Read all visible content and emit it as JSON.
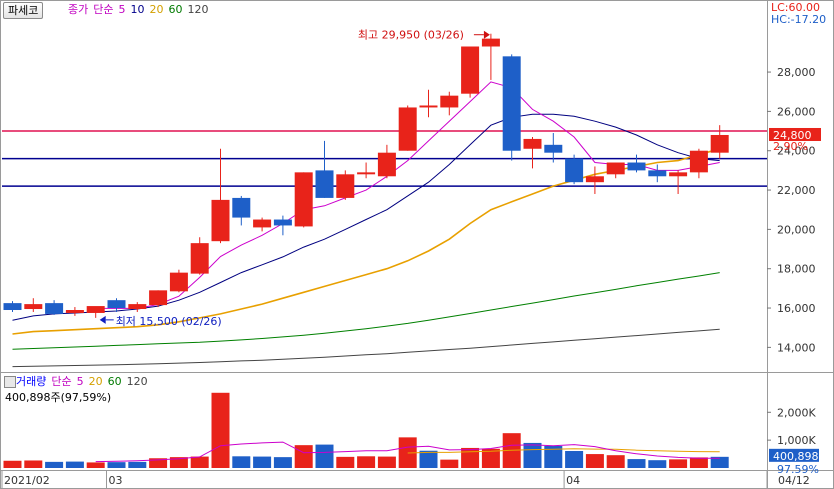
{
  "header": {
    "stock_name": "파세코",
    "main_legend": [
      {
        "text": "종가",
        "color": "#c000c0"
      },
      {
        "text": "단순",
        "color": "#c000c0"
      },
      {
        "text": "5",
        "color": "#c000c0"
      },
      {
        "text": "10",
        "color": "#00008b"
      },
      {
        "text": "20",
        "color": "#d4a000"
      },
      {
        "text": "60",
        "color": "#007a00"
      },
      {
        "text": "120",
        "color": "#444444"
      }
    ],
    "lc": "LC:60.00",
    "hc": "HC:-17.20"
  },
  "volume_header": {
    "legend": [
      {
        "text": "거래량",
        "color": "#0000ff"
      },
      {
        "text": "단순",
        "color": "#c000c0"
      },
      {
        "text": "5",
        "color": "#c000c0"
      },
      {
        "text": "20",
        "color": "#d4a000"
      },
      {
        "text": "60",
        "color": "#007a00"
      },
      {
        "text": "120",
        "color": "#444444"
      }
    ],
    "value_text": "400,898주(97,59%)"
  },
  "colors": {
    "up": "#e8231a",
    "down": "#1e5fc8",
    "ma5": "#cc00cc",
    "ma10": "#000080",
    "ma20": "#e8a000",
    "ma60": "#008000",
    "ma120": "#444444",
    "hline_red": "#e01050",
    "hline_blue": "#000090",
    "axis_text": "#333333"
  },
  "chart_data": [
    {
      "type": "candlestick",
      "title": "파세코",
      "ylim": [
        12900,
        30800
      ],
      "y_ticks": [
        "28,000",
        "26,000",
        "24,000",
        "22,000",
        "20,000",
        "18,000",
        "16,000",
        "14,000"
      ],
      "y_tick_values": [
        28000,
        26000,
        24000,
        22000,
        20000,
        18000,
        16000,
        14000
      ],
      "x_labels": [
        "2021/02",
        "03",
        "04",
        "04/12"
      ],
      "x_label_index": [
        0,
        5,
        27,
        36
      ],
      "candles": [
        {
          "o": 16250,
          "h": 16350,
          "l": 15800,
          "c": 15900
        },
        {
          "o": 15950,
          "h": 16500,
          "l": 15800,
          "c": 16200
        },
        {
          "o": 16250,
          "h": 16400,
          "l": 15650,
          "c": 15700
        },
        {
          "o": 15750,
          "h": 16050,
          "l": 15600,
          "c": 15900
        },
        {
          "o": 15750,
          "h": 16000,
          "l": 15500,
          "c": 16100
        },
        {
          "o": 16400,
          "h": 16500,
          "l": 15800,
          "c": 16000
        },
        {
          "o": 15950,
          "h": 16300,
          "l": 15800,
          "c": 16200
        },
        {
          "o": 16150,
          "h": 16900,
          "l": 16050,
          "c": 16900
        },
        {
          "o": 16850,
          "h": 17950,
          "l": 16800,
          "c": 17800
        },
        {
          "o": 17750,
          "h": 19600,
          "l": 17700,
          "c": 19300
        },
        {
          "o": 19400,
          "h": 24100,
          "l": 19300,
          "c": 21500
        },
        {
          "o": 21600,
          "h": 21700,
          "l": 20200,
          "c": 20600
        },
        {
          "o": 20100,
          "h": 20600,
          "l": 19900,
          "c": 20500
        },
        {
          "o": 20500,
          "h": 20700,
          "l": 19700,
          "c": 20200
        },
        {
          "o": 20150,
          "h": 22900,
          "l": 20100,
          "c": 22900
        },
        {
          "o": 23000,
          "h": 24500,
          "l": 21600,
          "c": 21600
        },
        {
          "o": 21600,
          "h": 23000,
          "l": 21500,
          "c": 22800
        },
        {
          "o": 22800,
          "h": 23400,
          "l": 22600,
          "c": 22900
        },
        {
          "o": 22700,
          "h": 24300,
          "l": 22600,
          "c": 23900
        },
        {
          "o": 24000,
          "h": 26300,
          "l": 24000,
          "c": 26200
        },
        {
          "o": 26200,
          "h": 27100,
          "l": 25700,
          "c": 26300
        },
        {
          "o": 26200,
          "h": 27000,
          "l": 25800,
          "c": 26800
        },
        {
          "o": 26900,
          "h": 29300,
          "l": 26700,
          "c": 29300
        },
        {
          "o": 29300,
          "h": 29950,
          "l": 27600,
          "c": 29700
        },
        {
          "o": 28800,
          "h": 28900,
          "l": 23500,
          "c": 24000
        },
        {
          "o": 24100,
          "h": 24700,
          "l": 23100,
          "c": 24600
        },
        {
          "o": 24300,
          "h": 24900,
          "l": 23400,
          "c": 23900
        },
        {
          "o": 23600,
          "h": 23800,
          "l": 22300,
          "c": 22400
        },
        {
          "o": 22400,
          "h": 23200,
          "l": 21800,
          "c": 22700
        },
        {
          "o": 22800,
          "h": 23400,
          "l": 22600,
          "c": 23400
        },
        {
          "o": 23400,
          "h": 23800,
          "l": 22900,
          "c": 23000
        },
        {
          "o": 23000,
          "h": 23300,
          "l": 22400,
          "c": 22700
        },
        {
          "o": 22700,
          "h": 23000,
          "l": 21800,
          "c": 22900
        },
        {
          "o": 22900,
          "h": 24100,
          "l": 22600,
          "c": 24000
        },
        {
          "o": 23900,
          "h": 25300,
          "l": 23600,
          "c": 24800
        }
      ],
      "ma5": [
        null,
        null,
        null,
        null,
        15980,
        15980,
        15980,
        16180,
        16600,
        17560,
        18620,
        19200,
        19700,
        20300,
        21000,
        21200,
        21600,
        22000,
        22700,
        23500,
        24500,
        25500,
        26500,
        27500,
        27200,
        26100,
        25500,
        24700,
        23400,
        23300,
        23300,
        23000,
        23000,
        23200,
        23400
      ],
      "ma10": [
        15380,
        15600,
        15700,
        15750,
        15800,
        15850,
        15950,
        16100,
        16400,
        16800,
        17300,
        17800,
        18200,
        18600,
        19100,
        19500,
        20000,
        20500,
        21000,
        21700,
        22400,
        23300,
        24300,
        25300,
        25700,
        25850,
        25850,
        25750,
        25500,
        25200,
        24800,
        24300,
        23900,
        23600,
        23500
      ],
      "ma20": [
        14680,
        14800,
        14850,
        14900,
        14950,
        15000,
        15050,
        15150,
        15300,
        15500,
        15700,
        15950,
        16200,
        16500,
        16800,
        17100,
        17400,
        17700,
        18000,
        18400,
        18900,
        19500,
        20300,
        21000,
        21400,
        21800,
        22200,
        22500,
        22800,
        23000,
        23200,
        23400,
        23500,
        23800,
        24100
      ],
      "ma60": [
        13900,
        13940,
        13980,
        14020,
        14060,
        14100,
        14140,
        14180,
        14220,
        14260,
        14320,
        14380,
        14450,
        14530,
        14620,
        14720,
        14830,
        14950,
        15080,
        15220,
        15380,
        15550,
        15720,
        15900,
        16080,
        16250,
        16430,
        16610,
        16780,
        16950,
        17130,
        17300,
        17470,
        17630,
        17800
      ],
      "ma120": [
        13020,
        13040,
        13060,
        13080,
        13100,
        13120,
        13140,
        13170,
        13200,
        13230,
        13270,
        13310,
        13350,
        13400,
        13450,
        13500,
        13560,
        13620,
        13680,
        13750,
        13820,
        13890,
        13960,
        14040,
        14120,
        14200,
        14280,
        14360,
        14440,
        14520,
        14600,
        14680,
        14760,
        14840,
        14920
      ],
      "hlines": [
        {
          "value": 25000,
          "color": "red"
        },
        {
          "value": 23600,
          "color": "blue"
        },
        {
          "value": 22200,
          "color": "blue"
        }
      ],
      "annotations": {
        "high": {
          "text": "최고 29,950 (03/26)",
          "index": 23,
          "value": 29950
        },
        "low": {
          "text": "최저 15,500 (02/26)",
          "index": 4,
          "value": 15500
        }
      },
      "price_label": "24,800",
      "pct_label": "2.90%",
      "price_color": "#e8231a"
    },
    {
      "type": "bar",
      "title": "거래량",
      "ylim": [
        0,
        2800
      ],
      "y_ticks": [
        "2,000K",
        "1,000K"
      ],
      "y_tick_values": [
        2000,
        1000
      ],
      "values": [
        260,
        270,
        220,
        230,
        200,
        210,
        220,
        350,
        390,
        410,
        2700,
        420,
        410,
        390,
        820,
        840,
        400,
        420,
        410,
        1100,
        620,
        300,
        720,
        690,
        1250,
        900,
        790,
        610,
        500,
        460,
        320,
        280,
        310,
        380,
        401
      ],
      "ups": [
        true,
        true,
        false,
        false,
        true,
        false,
        false,
        true,
        true,
        true,
        true,
        false,
        false,
        false,
        true,
        false,
        true,
        true,
        true,
        true,
        false,
        true,
        true,
        true,
        true,
        false,
        false,
        false,
        true,
        true,
        false,
        false,
        true,
        true,
        false
      ],
      "ma5": [
        null,
        null,
        null,
        null,
        230,
        240,
        260,
        290,
        330,
        400,
        800,
        860,
        900,
        930,
        550,
        560,
        590,
        620,
        620,
        750,
        780,
        650,
        660,
        700,
        820,
        830,
        800,
        840,
        770,
        620,
        510,
        430,
        380,
        350,
        350
      ],
      "ma20": [
        null,
        null,
        null,
        null,
        null,
        null,
        null,
        null,
        null,
        null,
        null,
        null,
        null,
        null,
        null,
        null,
        null,
        null,
        null,
        540,
        560,
        560,
        580,
        600,
        640,
        660,
        670,
        690,
        680,
        670,
        640,
        620,
        600,
        590,
        580
      ],
      "value_label": "400,898",
      "pct_label": "97.59%"
    }
  ]
}
